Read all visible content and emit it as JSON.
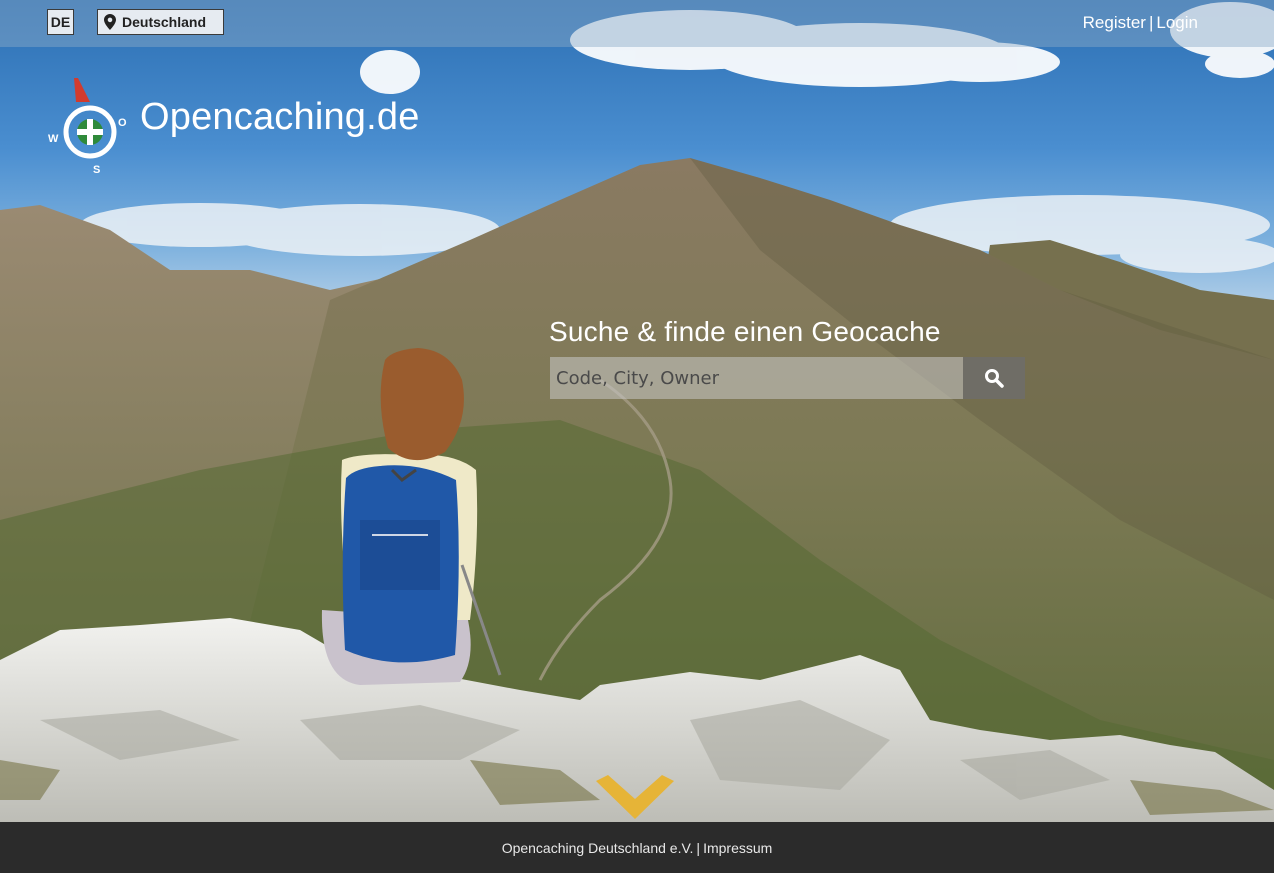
{
  "topbar": {
    "language_label": "DE",
    "country_label": "Deutschland",
    "register_label": "Register",
    "separator": "|",
    "login_label": "Login"
  },
  "logo": {
    "text": "Opencaching.de",
    "compass_letters": {
      "west": "W",
      "east": "O",
      "south": "S"
    }
  },
  "search": {
    "heading": "Suche & finde einen Geocache",
    "placeholder": "Code, City, Owner"
  },
  "footer": {
    "org_label": "Opencaching Deutschland e.V.",
    "separator": "|",
    "imprint_label": "Impressum"
  },
  "colors": {
    "accent_chevron": "#e6b437",
    "footer_bg": "#2b2b2b",
    "topbar_bg": "#8caac8"
  },
  "icons": {
    "country": "map-marker-icon",
    "search": "search-icon",
    "scroll": "chevron-down-icon"
  }
}
